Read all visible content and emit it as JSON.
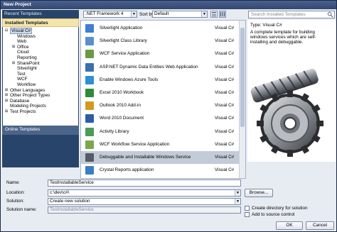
{
  "window": {
    "title": "New Project"
  },
  "left_panel": {
    "recent": "Recent Templates",
    "installed": "Installed Templates",
    "online": "Online Templates",
    "tree": [
      {
        "label": "Visual C#",
        "depth": 0,
        "expander": "⊟",
        "selected": true
      },
      {
        "label": "Windows",
        "depth": 1,
        "expander": "",
        "selected": false
      },
      {
        "label": "Web",
        "depth": 1,
        "expander": "",
        "selected": false
      },
      {
        "label": "Office",
        "depth": 1,
        "expander": "⊞",
        "selected": false
      },
      {
        "label": "Cloud",
        "depth": 1,
        "expander": "",
        "selected": false
      },
      {
        "label": "Reporting",
        "depth": 1,
        "expander": "",
        "selected": false
      },
      {
        "label": "SharePoint",
        "depth": 1,
        "expander": "⊞",
        "selected": false
      },
      {
        "label": "Silverlight",
        "depth": 1,
        "expander": "",
        "selected": false
      },
      {
        "label": "Test",
        "depth": 1,
        "expander": "",
        "selected": false
      },
      {
        "label": "WCF",
        "depth": 1,
        "expander": "",
        "selected": false
      },
      {
        "label": "Workflow",
        "depth": 1,
        "expander": "",
        "selected": false
      },
      {
        "label": "Other Languages",
        "depth": 0,
        "expander": "⊞",
        "selected": false
      },
      {
        "label": "Other Project Types",
        "depth": 0,
        "expander": "⊞",
        "selected": false
      },
      {
        "label": "Database",
        "depth": 0,
        "expander": "⊞",
        "selected": false
      },
      {
        "label": "Modeling Projects",
        "depth": 0,
        "expander": "",
        "selected": false
      },
      {
        "label": "Test Projects",
        "depth": 0,
        "expander": "⊞",
        "selected": false
      }
    ]
  },
  "toolbar": {
    "framework": ".NET Framework 4",
    "sort_label": "Sort by:",
    "sort_value": "Default"
  },
  "templates": [
    {
      "name": "Silverlight Application",
      "lang": "Visual C#",
      "icon": "silverlight-icon",
      "color": "#3e7fd1",
      "selected": false
    },
    {
      "name": "Silverlight Class Library",
      "lang": "Visual C#",
      "icon": "silverlight-library-icon",
      "color": "#5a8fcf",
      "selected": false
    },
    {
      "name": "WCF Service Application",
      "lang": "Visual C#",
      "icon": "wcf-icon",
      "color": "#6a9a43",
      "selected": false
    },
    {
      "name": "ASP.NET Dynamic Data Entities Web Application",
      "lang": "Visual C#",
      "icon": "asp-dynamic-icon",
      "color": "#3a6fb0",
      "selected": false
    },
    {
      "name": "Enable Windows Azure Tools",
      "lang": "Visual C#",
      "icon": "azure-icon",
      "color": "#2d8fd6",
      "selected": false
    },
    {
      "name": "Excel 2010 Workbook",
      "lang": "Visual C#",
      "icon": "excel-icon",
      "color": "#2e8b3a",
      "selected": false
    },
    {
      "name": "Outlook 2010 Add-in",
      "lang": "Visual C#",
      "icon": "outlook-icon",
      "color": "#d39b1c",
      "selected": false
    },
    {
      "name": "Word 2010 Document",
      "lang": "Visual C#",
      "icon": "word-icon",
      "color": "#2b5ea8",
      "selected": false
    },
    {
      "name": "Activity Library",
      "lang": "Visual C#",
      "icon": "activity-icon",
      "color": "#4a9c57",
      "selected": false
    },
    {
      "name": "WCF Workflow Service Application",
      "lang": "Visual C#",
      "icon": "workflow-icon",
      "color": "#7aa84b",
      "selected": false
    },
    {
      "name": "Debuggable and Installable Windows Service",
      "lang": "Visual C#",
      "icon": "service-gear-icon",
      "color": "#555b66",
      "selected": true
    },
    {
      "name": "Crystal Reports application",
      "lang": "Visual C#",
      "icon": "crystal-reports-icon",
      "color": "#3b7ec2",
      "selected": false
    }
  ],
  "details": {
    "search_placeholder": "Search Installed Templates",
    "type_label": "Type:",
    "type_value": "Visual C#",
    "description": "A complete template for building windows services which are self-installing and debuggable."
  },
  "form": {
    "name_label": "Name:",
    "name_value": "TestInstallableService",
    "location_label": "Location:",
    "location_value": "c:\\dev\\c#\\",
    "solution_label": "Solution:",
    "solution_value": "Create new solution",
    "solution_name_label": "Solution name:",
    "solution_name_value": "TestInstallableService",
    "browse": "Browse...",
    "create_dir": "Create directory for solution",
    "add_source": "Add to source control",
    "ok": "OK",
    "cancel": "Cancel"
  }
}
